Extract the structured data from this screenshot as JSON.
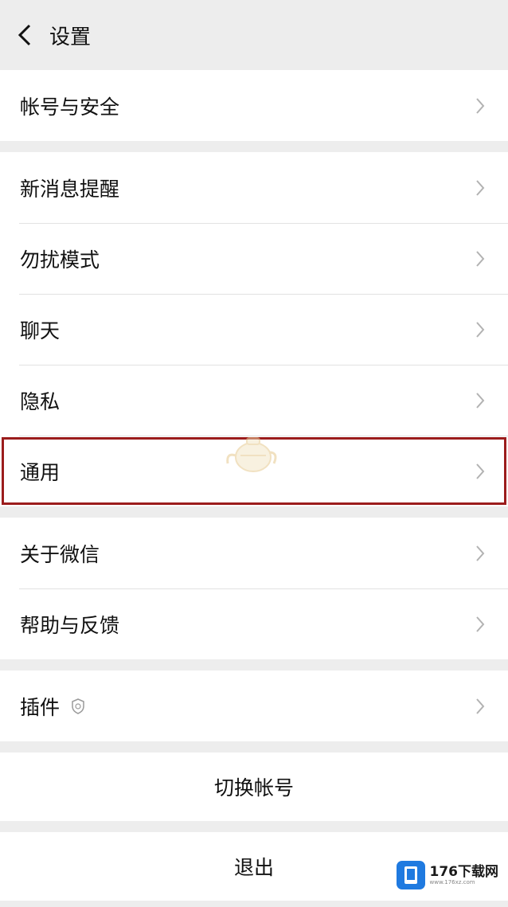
{
  "header": {
    "title": "设置",
    "back_icon": "chevron-left-icon"
  },
  "groups": [
    {
      "items": [
        {
          "label": "帐号与安全"
        }
      ]
    },
    {
      "items": [
        {
          "label": "新消息提醒"
        },
        {
          "label": "勿扰模式"
        },
        {
          "label": "聊天"
        },
        {
          "label": "隐私"
        },
        {
          "label": "通用",
          "highlighted": true
        }
      ]
    },
    {
      "items": [
        {
          "label": "关于微信"
        },
        {
          "label": "帮助与反馈"
        }
      ]
    },
    {
      "items": [
        {
          "label": "插件",
          "icon": "shield-badge-icon"
        }
      ]
    }
  ],
  "actions": {
    "switch_account": "切换帐号",
    "logout": "退出"
  },
  "watermark": {
    "brand": "176下载网",
    "sub": "www.176xz.com"
  },
  "colors": {
    "background": "#ededed",
    "highlight_border": "#9b1c1c",
    "watermark_blue": "#1f7ae0"
  }
}
